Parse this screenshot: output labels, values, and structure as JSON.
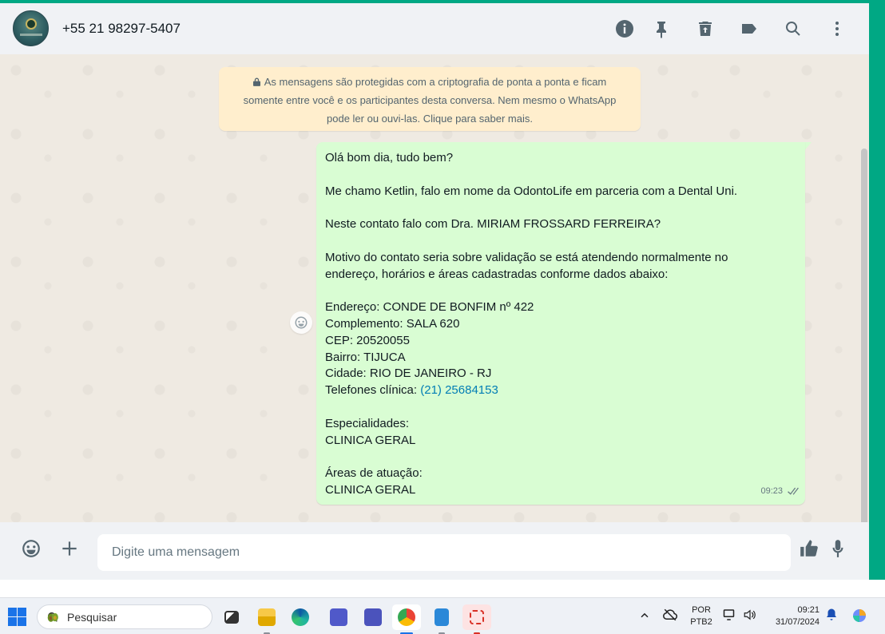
{
  "header": {
    "contact_name": "+55 21 98297-5407",
    "icons": [
      "info-icon",
      "pin-icon",
      "delete-icon",
      "label-icon",
      "search-icon",
      "menu-icon"
    ]
  },
  "encryption_note": {
    "line1": "As mensagens são protegidas com a criptografia de ponta a ponta e ficam",
    "line2": "somente entre você e os participantes desta conversa. Nem mesmo o WhatsApp",
    "line3": "pode ler ou ouvi-las. Clique para saber mais."
  },
  "message": {
    "greeting": "Olá bom dia, tudo bem?",
    "intro": "Me chamo Ketlin, falo em nome da OdontoLife em parceria com a Dental Uni.",
    "question": "Neste contato falo com Dra. MIRIAM FROSSARD FERREIRA?",
    "motive_line1": "Motivo do contato seria sobre validação se está atendendo normalmente no",
    "motive_line2": "endereço, horários e áreas cadastradas conforme dados abaixo:",
    "address": "Endereço: CONDE DE BONFIM nº 422",
    "complement": "Complemento: SALA 620",
    "cep": "CEP: 20520055",
    "neighborhood": "Bairro: TIJUCA",
    "city": "Cidade: RIO DE JANEIRO - RJ",
    "phones_label": "Telefones clínica: ",
    "phones_value": "(21) 25684153",
    "specialties_label": "Especialidades:",
    "specialties_value": "CLINICA GERAL",
    "areas_label": "Áreas de atuação:",
    "areas_value": "CLINICA GERAL",
    "time": "09:23",
    "status": "delivered"
  },
  "composer": {
    "placeholder": "Digite uma mensagem"
  },
  "taskbar": {
    "search_text": "Pesquisar",
    "language_top": "POR",
    "language_bottom": "PTB2",
    "time": "09:21",
    "date": "31/07/2024",
    "apps": [
      "task-view",
      "file-explorer",
      "edge",
      "teams",
      "teams-new",
      "chrome",
      "notepad",
      "snipping-tool"
    ]
  },
  "colors": {
    "accent": "#00a884",
    "bubble": "#d9fdd3",
    "encryption_bg": "#ffeecd",
    "chat_bg": "#efeae2",
    "link": "#027eb5"
  }
}
